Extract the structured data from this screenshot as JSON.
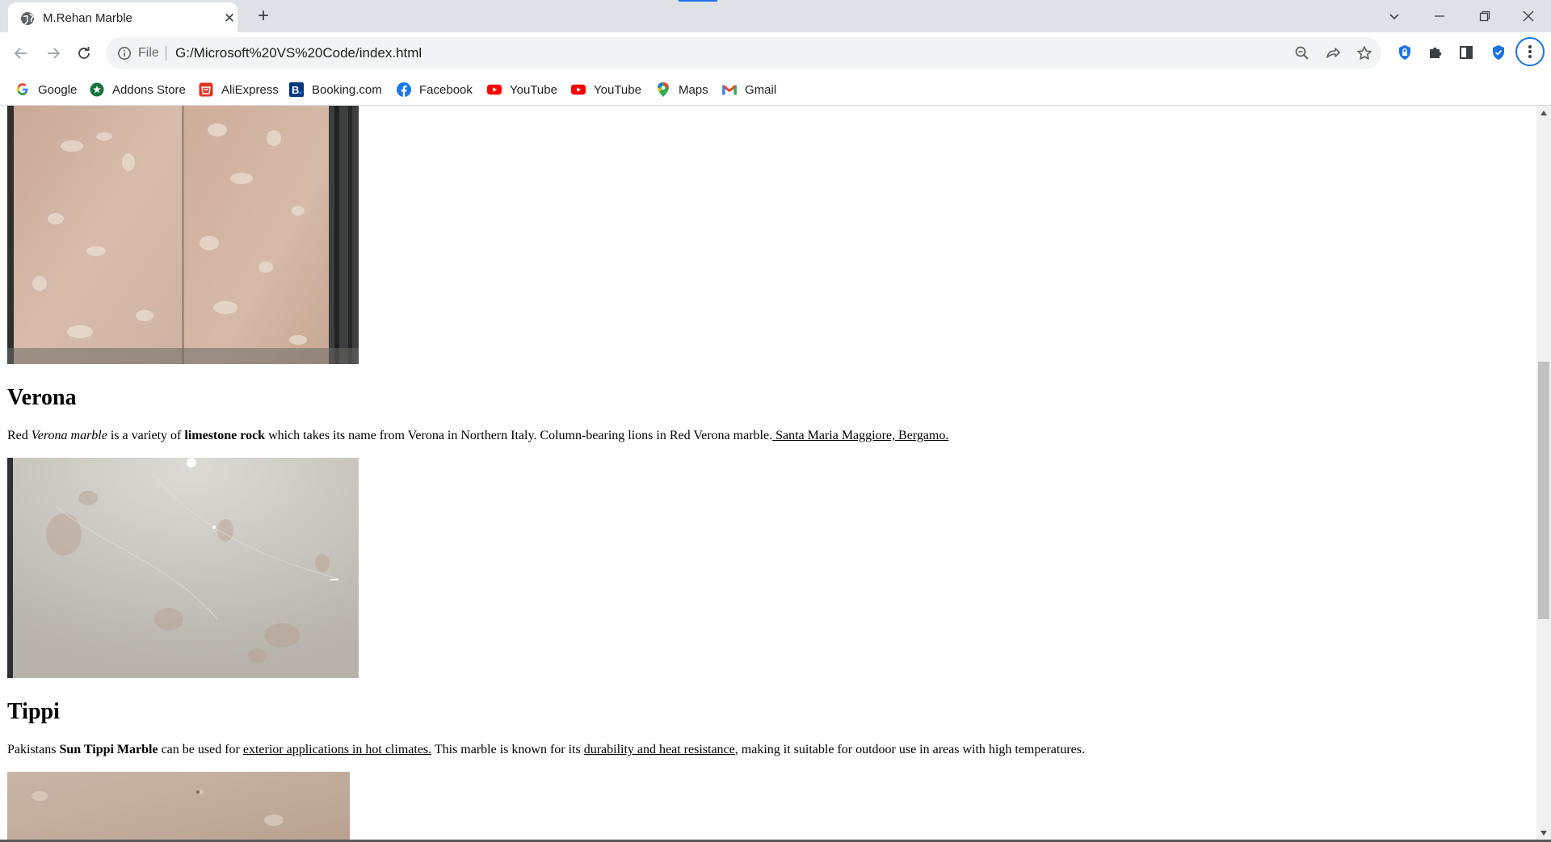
{
  "browser": {
    "tab_title": "M.Rehan Marble",
    "scheme_label": "File",
    "url": "G:/Microsoft%20VS%20Code/index.html",
    "bookmarks": [
      {
        "label": "Google",
        "icon": "google-icon"
      },
      {
        "label": "Addons Store",
        "icon": "addons-store-icon"
      },
      {
        "label": "AliExpress",
        "icon": "aliexpress-icon"
      },
      {
        "label": "Booking.com",
        "icon": "booking-icon"
      },
      {
        "label": "Facebook",
        "icon": "facebook-icon"
      },
      {
        "label": "YouTube",
        "icon": "youtube-icon"
      },
      {
        "label": "YouTube",
        "icon": "youtube-icon"
      },
      {
        "label": "Maps",
        "icon": "maps-icon"
      },
      {
        "label": "Gmail",
        "icon": "gmail-icon"
      }
    ],
    "accent": "#1a73e8"
  },
  "page": {
    "verona": {
      "title": "Verona",
      "p1": "Red ",
      "p2": "Verona marble",
      "p3": " is a variety of ",
      "p4": "limestone rock",
      "p5": " which takes its name from Verona in Northern Italy. Column-bearing lions in Red Verona marble.",
      "p6": " Santa Maria Maggiore, Bergamo."
    },
    "tippi": {
      "title": "Tippi",
      "p1": "Pakistans ",
      "p2": "Sun Tippi Marble",
      "p3": " can be used for ",
      "p4": "exterior applications in hot climates.",
      "p5": " This marble is known for its ",
      "p6": "durability and heat resistance",
      "p7": ", making it suitable for outdoor use in areas with high temperatures."
    }
  }
}
